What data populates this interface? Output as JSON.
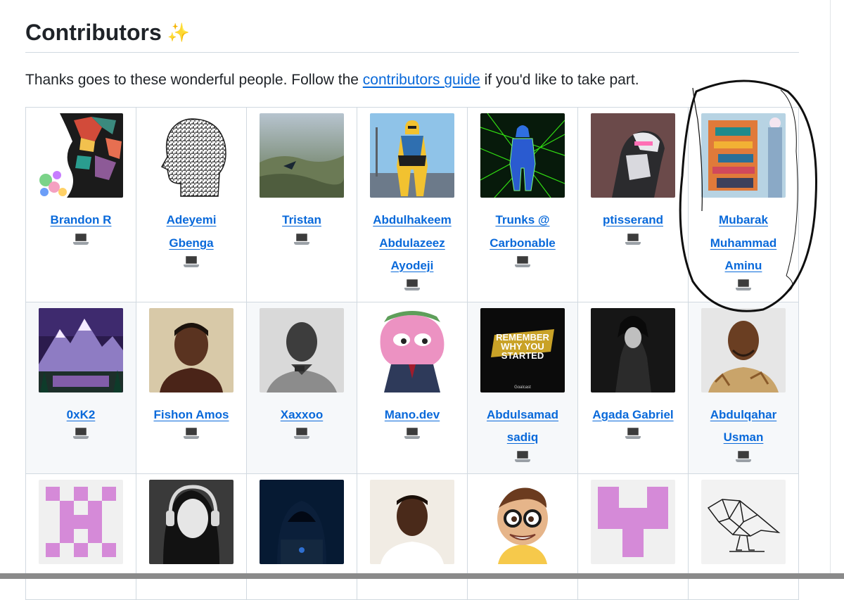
{
  "section": {
    "title": "Contributors",
    "sparkles_icon": "✨",
    "intro_before": "Thanks goes to these wonderful people. Follow the ",
    "intro_link": "contributors guide",
    "intro_after": " if you'd like to take part."
  },
  "contributors": [
    {
      "name": "Brandon R",
      "avatar": "abstract-face-avatar"
    },
    {
      "name": "Adeyemi Gbenga",
      "avatar": "maze-head-avatar"
    },
    {
      "name": "Tristan",
      "avatar": "wingsuit-avatar"
    },
    {
      "name": "Abdulhakeem Abdulazeez Ayodeji",
      "avatar": "superhero-avatar"
    },
    {
      "name": "Trunks @ Carbonable",
      "avatar": "laser-figure-avatar"
    },
    {
      "name": "ptisserand",
      "avatar": "robot-avatar"
    },
    {
      "name": "Mubarak Muhammad Aminu",
      "avatar": "colorful-building-avatar"
    },
    {
      "name": "0xK2",
      "avatar": "pixel-mountain-avatar"
    },
    {
      "name": "Fishon Amos",
      "avatar": "portrait-avatar"
    },
    {
      "name": "Xaxxoo",
      "avatar": "portrait-bw-avatar"
    },
    {
      "name": "Mano.dev",
      "avatar": "pepe-avatar"
    },
    {
      "name": "Abdulsamad sadiq",
      "avatar": "remember-poster-avatar"
    },
    {
      "name": "Agada Gabriel",
      "avatar": "anime-avatar"
    },
    {
      "name": "Abdulqahar Usman",
      "avatar": "portrait-avatar"
    },
    {
      "name": "",
      "avatar": "identicon-avatar"
    },
    {
      "name": "",
      "avatar": "headphones-girl-avatar"
    },
    {
      "name": "",
      "avatar": "hacker-avatar"
    },
    {
      "name": "",
      "avatar": "portrait-avatar"
    },
    {
      "name": "",
      "avatar": "cartoon-boy-avatar"
    },
    {
      "name": "",
      "avatar": "identicon-avatar"
    },
    {
      "name": "",
      "avatar": "wire-bird-avatar"
    }
  ],
  "avatar_text": {
    "poster": "REMEMBER WHY YOU STARTED",
    "poster_brand": "Goalcast"
  },
  "contribution_icon": "laptop-icon",
  "annotation": "hand-drawn-circle-around-mubarak",
  "colors": {
    "link": "#0969da",
    "text": "#1f2328",
    "border": "#d1d9e0",
    "stripe": "#f6f8fa"
  }
}
